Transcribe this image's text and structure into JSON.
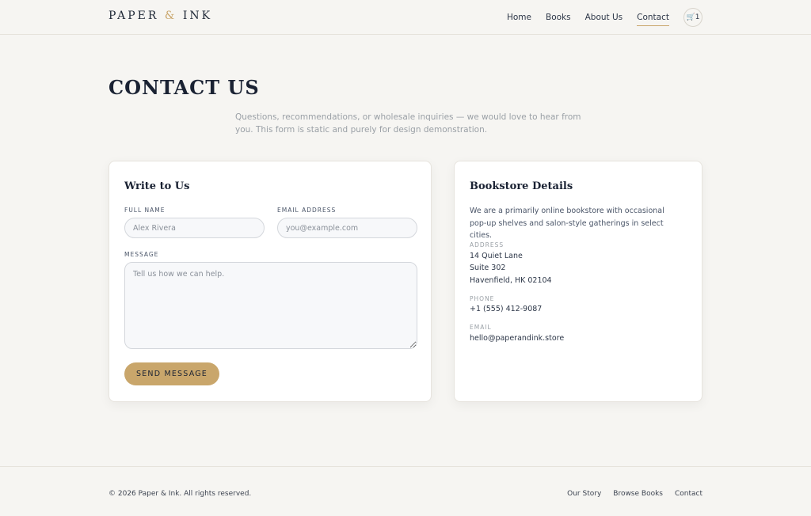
{
  "header": {
    "logo_left": "PAPER",
    "logo_amp": "&",
    "logo_right": "INK",
    "nav": [
      "Home",
      "Books",
      "About Us",
      "Contact"
    ],
    "active_nav": "Contact",
    "cart_icon": "cart-icon",
    "cart_glyph": "🛒",
    "cart_count": "1"
  },
  "hero": {
    "title": "CONTACT US",
    "subtitle": "Questions, recommendations, or wholesale inquiries — we would love to hear from you. This form is static and purely for design demonstration."
  },
  "form": {
    "title": "Write to Us",
    "name_label": "FULL NAME",
    "name_placeholder": "Alex Rivera",
    "email_label": "EMAIL ADDRESS",
    "email_placeholder": "you@example.com",
    "message_label": "MESSAGE",
    "message_placeholder": "Tell us how we can help.",
    "submit_label": "SEND MESSAGE"
  },
  "details": {
    "title": "Bookstore Details",
    "about": "We are a primarily online bookstore with occasional pop-up shelves and salon-style gatherings in select cities.",
    "address_label": "ADDRESS",
    "address_lines": [
      "14 Quiet Lane",
      "Suite 302",
      "Havenfield, HK 02104"
    ],
    "phone_label": "PHONE",
    "phone": "+1 (555) 412-9087",
    "email_label": "EMAIL",
    "email": "hello@paperandink.store"
  },
  "footer": {
    "copyright": "© 2026 Paper & Ink. All rights reserved.",
    "links": [
      "Our Story",
      "Browse Books",
      "Contact"
    ]
  },
  "colors": {
    "background": "#f6f5f2",
    "accent": "#c9a66b",
    "text": "#1a2233"
  }
}
